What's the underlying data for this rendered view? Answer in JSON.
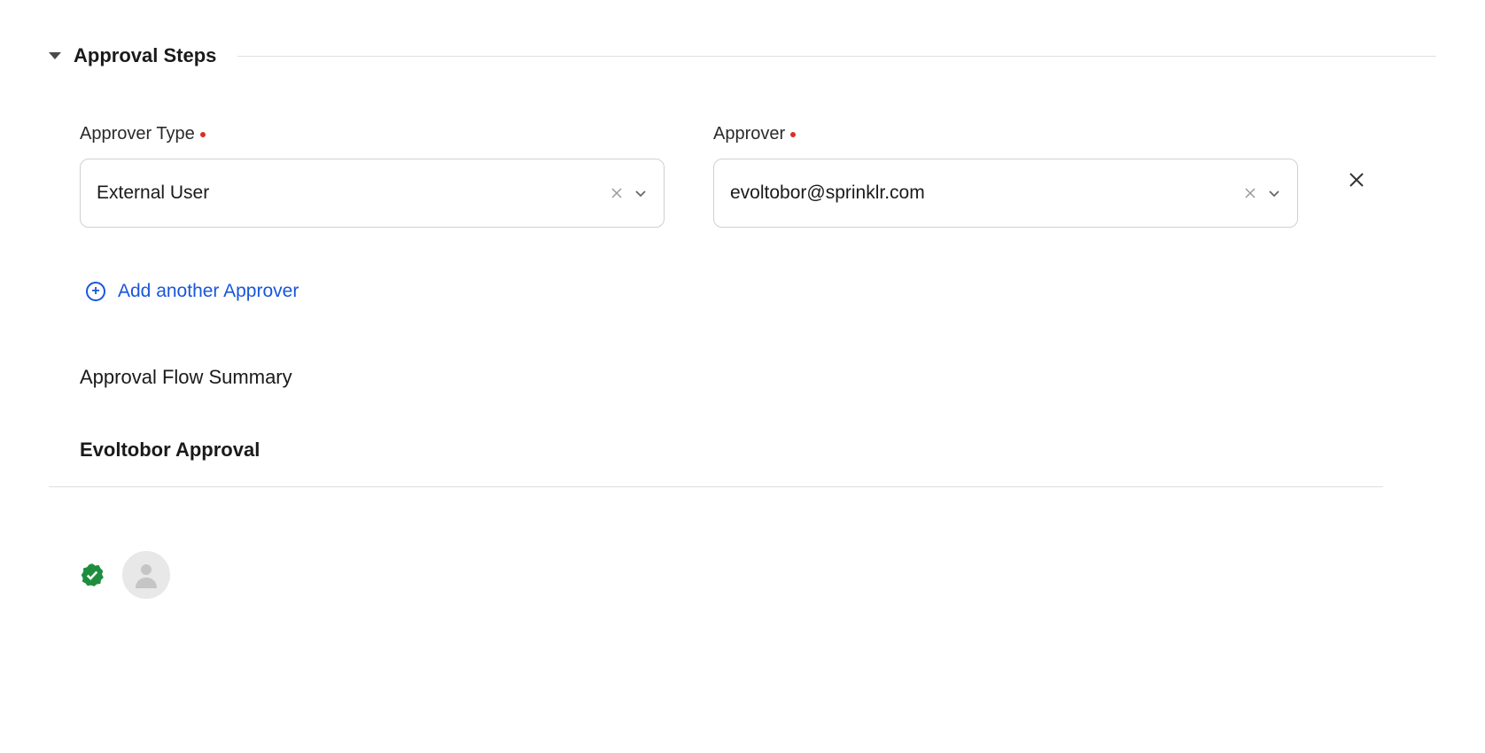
{
  "section": {
    "title": "Approval Steps"
  },
  "form": {
    "approver_type": {
      "label": "Approver Type",
      "value": "External User"
    },
    "approver": {
      "label": "Approver",
      "value": "evoltobor@sprinklr.com"
    }
  },
  "add_approver_label": "Add another Approver",
  "summary": {
    "title": "Approval Flow Summary",
    "approval_name": "Evoltobor Approval"
  }
}
